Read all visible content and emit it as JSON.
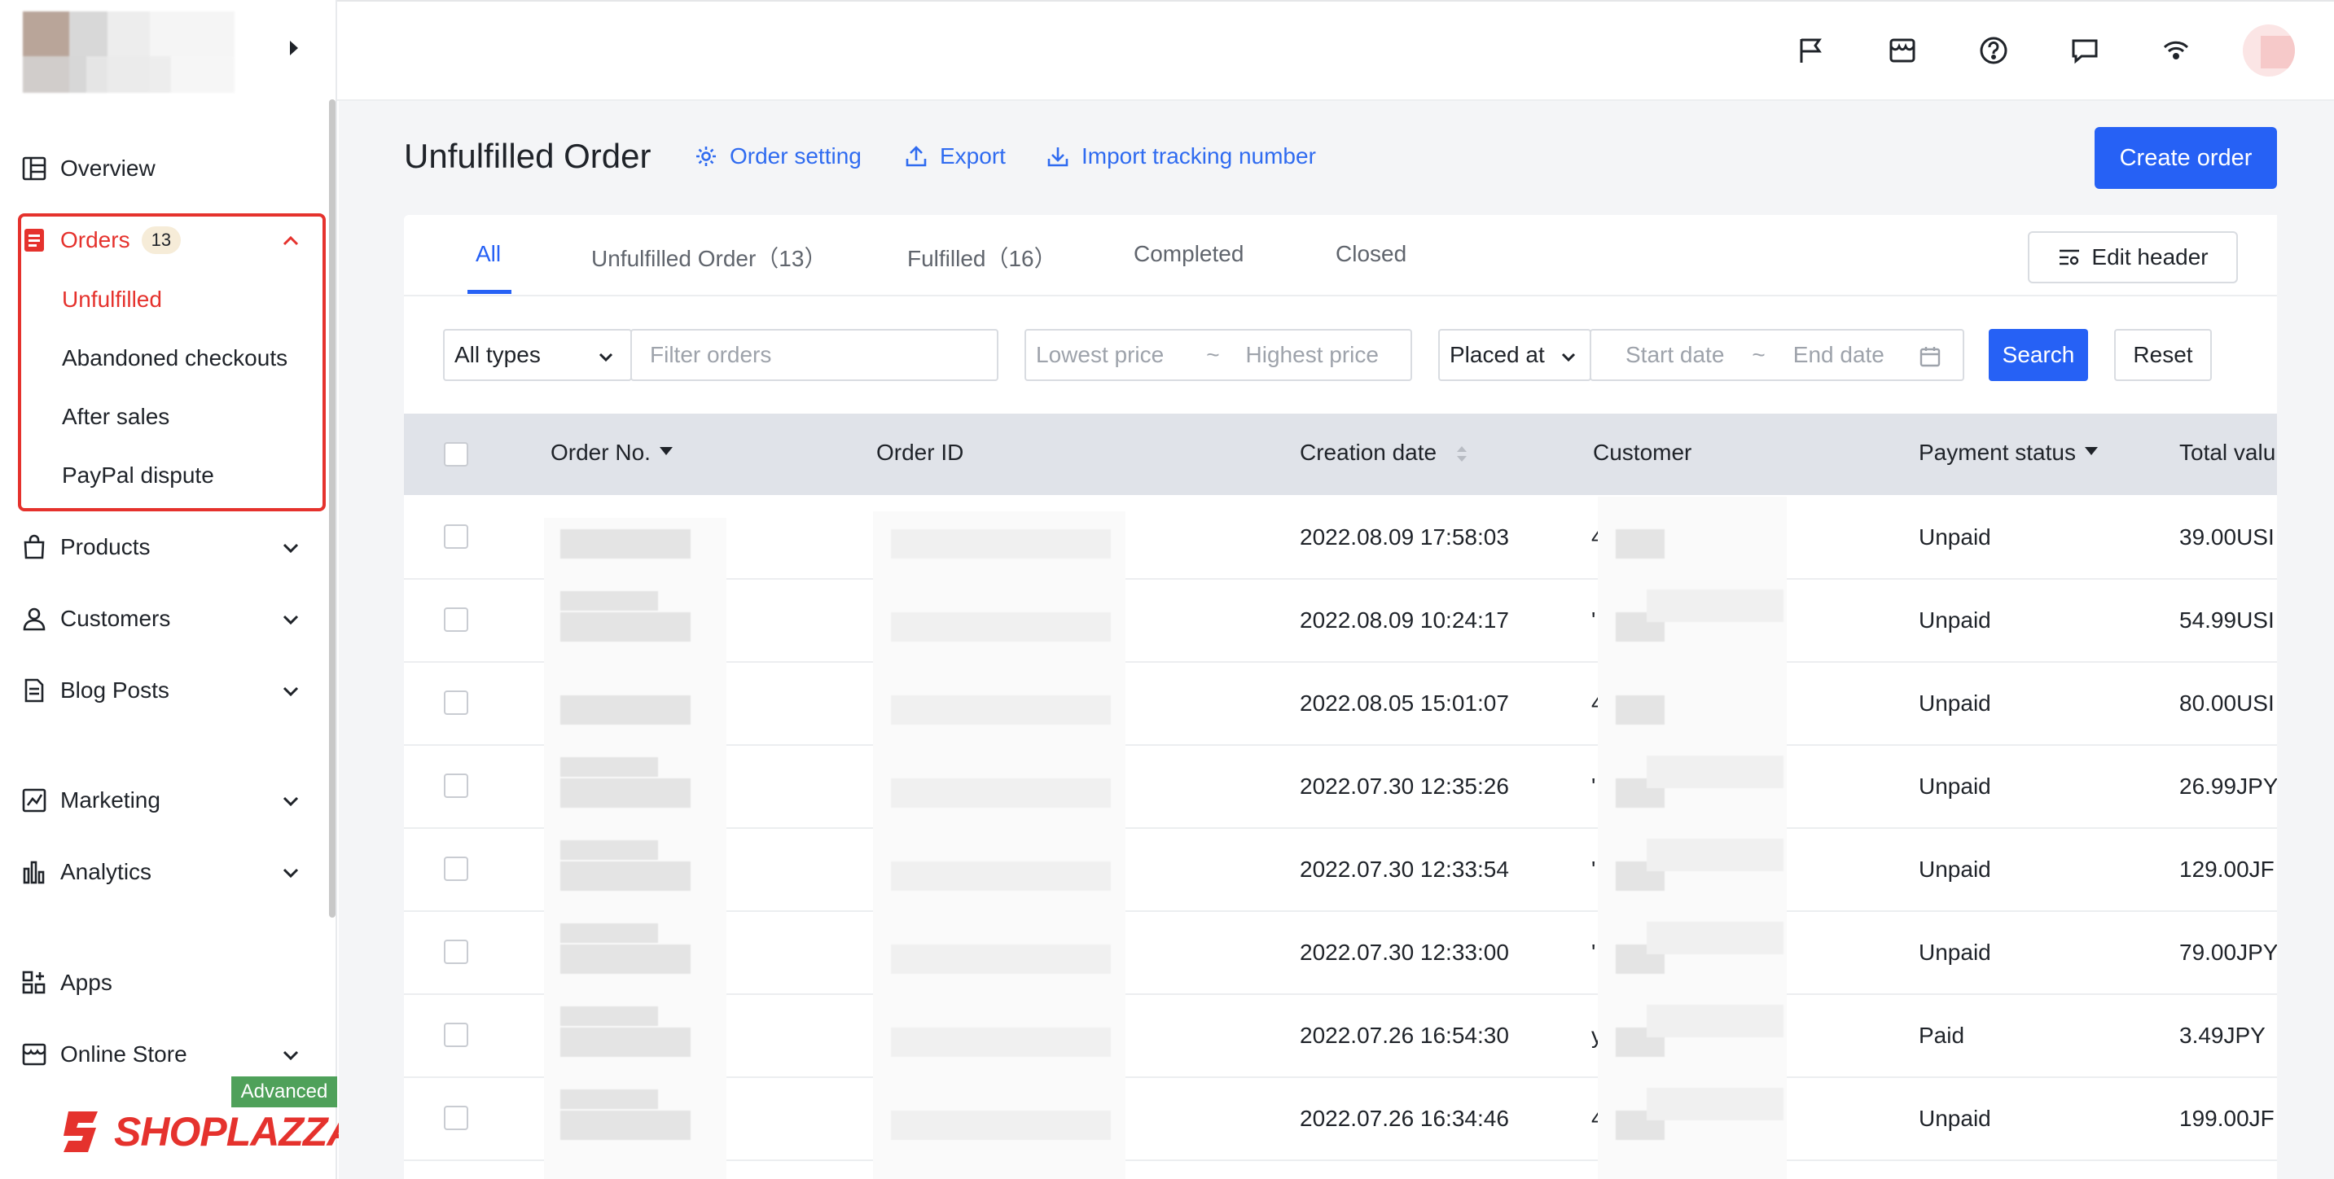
{
  "sidebar": {
    "nav": {
      "overview": "Overview",
      "orders": "Orders",
      "orders_badge": "13",
      "products": "Products",
      "customers": "Customers",
      "blog_posts": "Blog Posts",
      "marketing": "Marketing",
      "analytics": "Analytics",
      "apps": "Apps",
      "online_store": "Online Store"
    },
    "orders_sub": {
      "unfulfilled": "Unfulfilled",
      "abandoned": "Abandoned checkouts",
      "after_sales": "After sales",
      "paypal": "PayPal dispute"
    },
    "plan_badge": "Advanced",
    "brand": "SHOPLAZZA",
    "accent_color": "#e5322d"
  },
  "header": {
    "icons": [
      "flag-icon",
      "store-icon",
      "help-icon",
      "message-icon",
      "wifi-icon",
      "avatar"
    ]
  },
  "page": {
    "title": "Unfulfilled Order",
    "links": {
      "order_setting": "Order setting",
      "export": "Export",
      "import_tracking": "Import tracking number"
    },
    "create_button": "Create order",
    "primary_color": "#2661f5"
  },
  "tabs": {
    "all": "All",
    "unfulfilled": "Unfulfilled Order（13）",
    "fulfilled": "Fulfilled（16）",
    "completed": "Completed",
    "closed": "Closed",
    "edit_header": "Edit header"
  },
  "filters": {
    "type_select": "All types",
    "filter_placeholder": "Filter orders",
    "lowest_price": "Lowest price",
    "tilde": "~",
    "highest_price": "Highest price",
    "date_select": "Placed at",
    "start_date": "Start date",
    "end_date": "End date",
    "search": "Search",
    "reset": "Reset"
  },
  "table": {
    "columns": {
      "order_no": "Order No.",
      "order_id": "Order ID",
      "creation_date": "Creation date",
      "customer": "Customer",
      "payment_status": "Payment status",
      "total_value": "Total valu"
    },
    "rows": [
      {
        "date": "2022.08.09 17:58:03",
        "cust_prefix": "4",
        "payment": "Unpaid",
        "total": "39.00USI"
      },
      {
        "date": "2022.08.09 10:24:17",
        "cust_prefix": "'",
        "payment": "Unpaid",
        "total": "54.99USI"
      },
      {
        "date": "2022.08.05 15:01:07",
        "cust_prefix": "4",
        "payment": "Unpaid",
        "total": "80.00USI"
      },
      {
        "date": "2022.07.30 12:35:26",
        "cust_prefix": "'",
        "payment": "Unpaid",
        "total": "26.99JPY"
      },
      {
        "date": "2022.07.30 12:33:54",
        "cust_prefix": "'",
        "payment": "Unpaid",
        "total": "129.00JF"
      },
      {
        "date": "2022.07.30 12:33:00",
        "cust_prefix": "'",
        "payment": "Unpaid",
        "total": "79.00JPY"
      },
      {
        "date": "2022.07.26 16:54:30",
        "cust_prefix": "y",
        "payment": "Paid",
        "total": "3.49JPY"
      },
      {
        "date": "2022.07.26 16:34:46",
        "cust_prefix": "4",
        "payment": "Unpaid",
        "total": "199.00JF"
      }
    ]
  }
}
